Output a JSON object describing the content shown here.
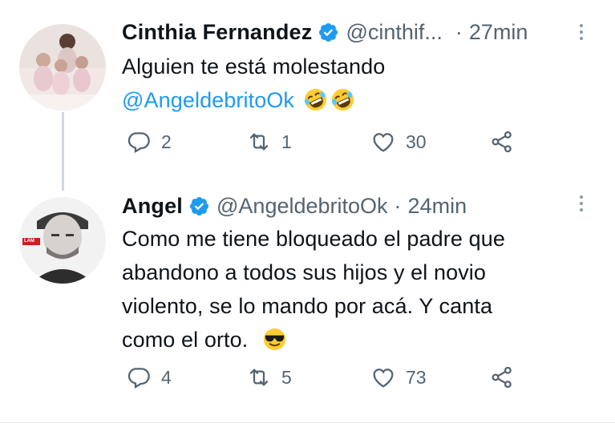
{
  "tweets": [
    {
      "name": "Cinthia Fernandez",
      "handle": "@cinthif...",
      "separator": "·",
      "time": "27min",
      "text_line1": "Alguien te está molestando",
      "mention": "@AngeldebritoOk",
      "emojis": [
        "rolling-on-floor-laughing-emoji",
        "rolling-on-floor-laughing-emoji"
      ],
      "replies": "2",
      "retweets": "1",
      "likes": "30"
    },
    {
      "name": "Angel",
      "handle": "@AngeldebritoOk",
      "separator": "·",
      "time": "24min",
      "text_lines": [
        "Como me tiene bloqueado el padre que",
        "abandono a todos sus hijos y el novio",
        "violento, se lo mando por acá. Y canta",
        "como el orto."
      ],
      "emojis": [
        "smiling-face-with-sunglasses-emoji"
      ],
      "avatar_badge": "LAM",
      "replies": "4",
      "retweets": "5",
      "likes": "73"
    }
  ],
  "colors": {
    "accent": "#1d9bf0",
    "secondary_text": "#536471",
    "primary_text": "#0f1419",
    "thread_line": "#cfd9de"
  }
}
